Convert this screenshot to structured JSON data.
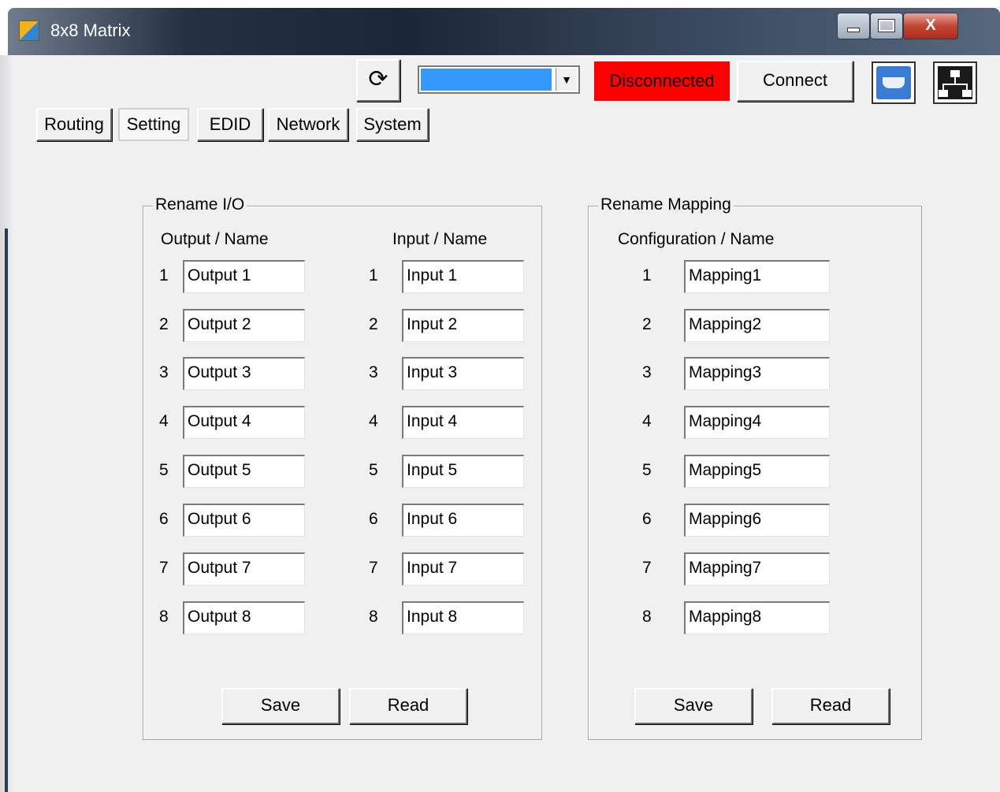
{
  "window": {
    "title": "8x8 Matrix",
    "close_glyph": "X"
  },
  "toolbar": {
    "refresh_glyph": "⟳",
    "port_selected": "",
    "status_text": "Disconnected",
    "status_color": "#ff0000",
    "connect_label": "Connect",
    "serial_icon": "serial-port-icon",
    "network_icon": "network-icon"
  },
  "tabs": [
    {
      "label": "Routing"
    },
    {
      "label": "Setting",
      "active": true
    },
    {
      "label": "EDID"
    },
    {
      "label": "Network"
    },
    {
      "label": "System"
    }
  ],
  "rename_io": {
    "legend": "Rename  I/O",
    "output_header": "Output  /  Name",
    "input_header": "Input  /  Name",
    "numbers": [
      "1",
      "2",
      "3",
      "4",
      "5",
      "6",
      "7",
      "8"
    ],
    "outputs": [
      "Output 1",
      "Output 2",
      "Output 3",
      "Output 4",
      "Output 5",
      "Output 6",
      "Output 7",
      "Output 8"
    ],
    "inputs": [
      "Input 1",
      "Input 2",
      "Input 3",
      "Input 4",
      "Input 5",
      "Input 6",
      "Input 7",
      "Input 8"
    ],
    "save_label": "Save",
    "read_label": "Read"
  },
  "rename_mapping": {
    "legend": "Rename Mapping",
    "header": "Configuration / Name",
    "numbers": [
      "1",
      "2",
      "3",
      "4",
      "5",
      "6",
      "7",
      "8"
    ],
    "mappings": [
      "Mapping1",
      "Mapping2",
      "Mapping3",
      "Mapping4",
      "Mapping5",
      "Mapping6",
      "Mapping7",
      "Mapping8"
    ],
    "save_label": "Save",
    "read_label": "Read"
  }
}
